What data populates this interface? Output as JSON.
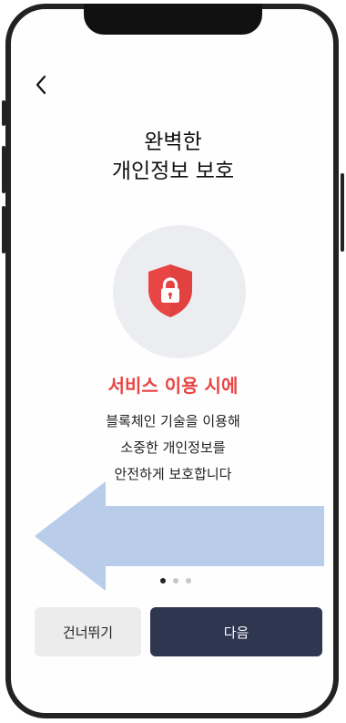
{
  "nav": {
    "back_icon": "chevron-left-icon"
  },
  "title": {
    "line1": "완벽한",
    "line2": "개인정보 보호"
  },
  "hero": {
    "icon": "shield-lock-icon",
    "accent_color": "#e84545"
  },
  "content": {
    "subtitle": "서비스 이용 시에",
    "lines": [
      "블록체인 기술을 이용해",
      "소중한 개인정보를",
      "안전하게 보호합니다"
    ]
  },
  "overlay": {
    "icon": "arrow-left-icon",
    "color": "#b9cdea"
  },
  "pagination": {
    "current": 1,
    "total": 3
  },
  "buttons": {
    "skip_label": "건너뛰기",
    "next_label": "다음"
  }
}
